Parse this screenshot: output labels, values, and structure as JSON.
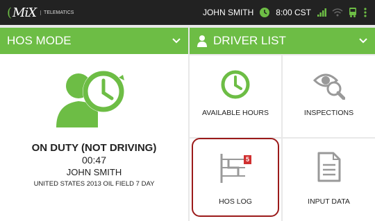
{
  "topbar": {
    "logo_text": "MiX",
    "logo_subtext": "TELEMATICS",
    "user_name": "JOHN SMITH",
    "time": "8:00 CST",
    "colors": {
      "bg": "#222222",
      "accent": "#6dbd45"
    }
  },
  "left": {
    "header": "HOS MODE",
    "status": "ON DUTY (NOT DRIVING)",
    "timer": "00:47",
    "driver": "JOHN SMITH",
    "ruleset": "UNITED STATES 2013 OIL FIELD 7 DAY"
  },
  "right": {
    "header": "DRIVER LIST",
    "tiles": [
      {
        "label": "AVAILABLE HOURS",
        "icon": "clock-icon"
      },
      {
        "label": "INSPECTIONS",
        "icon": "inspect-icon"
      },
      {
        "label": "HOS LOG",
        "icon": "log-icon",
        "badge": "5"
      },
      {
        "label": "INPUT DATA",
        "icon": "document-icon"
      }
    ]
  },
  "colors": {
    "accent": "#6dbd45",
    "highlight": "#9b1a1a",
    "badge": "#d03030"
  }
}
